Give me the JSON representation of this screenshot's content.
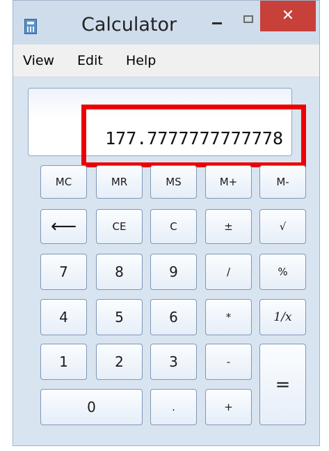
{
  "window": {
    "title": "Calculator",
    "close_glyph": "✕",
    "app_icon": "calculator-icon",
    "min_icon": "minimize-icon",
    "max_icon": "maximize-icon"
  },
  "menu": {
    "items": [
      "View",
      "Edit",
      "Help"
    ]
  },
  "display": {
    "value": "177.7777777777778"
  },
  "keys": {
    "mc": "MC",
    "mr": "MR",
    "ms": "MS",
    "mplus": "M+",
    "mminus": "M-",
    "backspace": "⟵",
    "ce": "CE",
    "c": "C",
    "plusminus": "±",
    "sqrt": "√",
    "k7": "7",
    "k8": "8",
    "k9": "9",
    "div": "/",
    "percent": "%",
    "k4": "4",
    "k5": "5",
    "k6": "6",
    "mul": "*",
    "recip": "1/x",
    "k1": "1",
    "k2": "2",
    "k3": "3",
    "sub": "-",
    "equals": "=",
    "k0": "0",
    "dot": ".",
    "add": "+"
  },
  "colors": {
    "highlight": "#ee0000",
    "close": "#c7403a",
    "window": "#cfdceb"
  }
}
